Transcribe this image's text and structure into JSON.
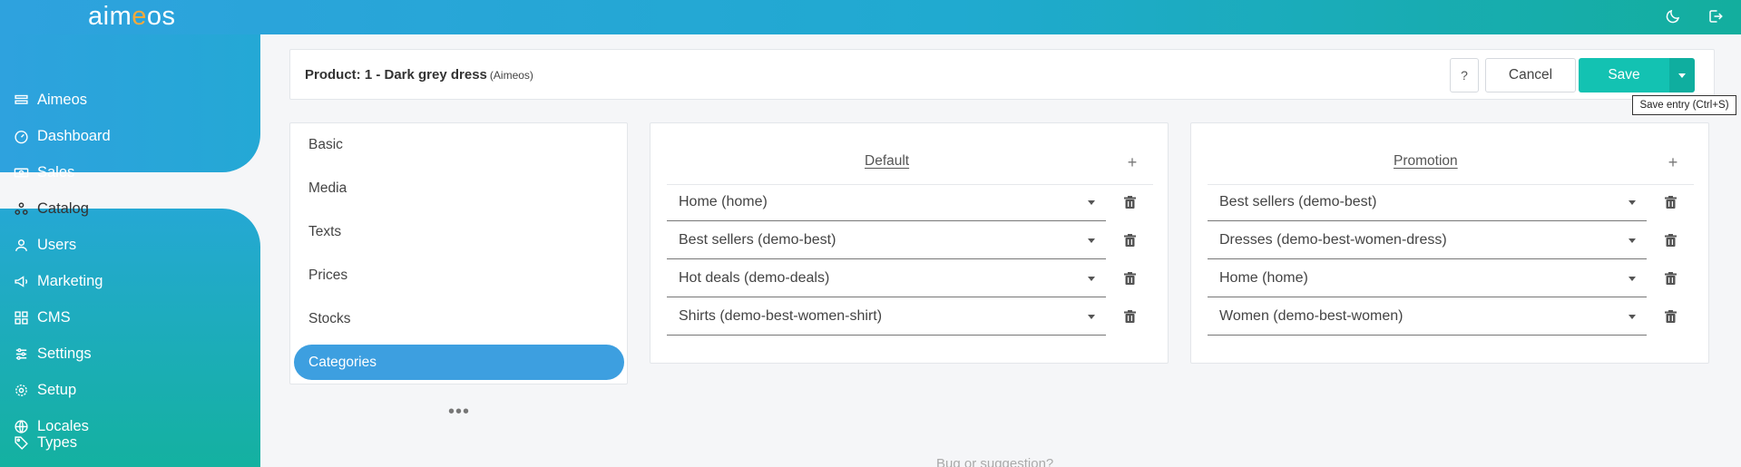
{
  "app": {
    "logo_text_before": "aim",
    "logo_text_e": "e",
    "logo_text_after": "os"
  },
  "topbar": {
    "icons": [
      "moon-icon",
      "logout-icon"
    ]
  },
  "sidebar": {
    "items": [
      {
        "label": "Aimeos",
        "icon": "list-icon",
        "active": false
      },
      {
        "label": "Dashboard",
        "icon": "gauge-icon",
        "active": false
      },
      {
        "label": "Sales",
        "icon": "money-icon",
        "active": false
      },
      {
        "label": "Catalog",
        "icon": "tree-icon",
        "active": true
      },
      {
        "label": "Users",
        "icon": "user-icon",
        "active": false
      },
      {
        "label": "Marketing",
        "icon": "megaphone-icon",
        "active": false
      },
      {
        "label": "CMS",
        "icon": "grid-icon",
        "active": false
      },
      {
        "label": "Settings",
        "icon": "sliders-icon",
        "active": false
      },
      {
        "label": "Setup",
        "icon": "gear-icon",
        "active": false
      },
      {
        "label": "Locales",
        "icon": "globe-icon",
        "active": false
      },
      {
        "label": "Types",
        "icon": "tag-icon",
        "active": false
      }
    ]
  },
  "header": {
    "title": "Product: 1 - Dark grey dress",
    "site": "(Aimeos)",
    "help_label": "?",
    "cancel_label": "Cancel",
    "save_label": "Save",
    "save_tooltip": "Save entry (Ctrl+S)"
  },
  "tabs": [
    {
      "label": "Basic",
      "active": false
    },
    {
      "label": "Media",
      "active": false
    },
    {
      "label": "Texts",
      "active": false
    },
    {
      "label": "Prices",
      "active": false
    },
    {
      "label": "Stocks",
      "active": false
    },
    {
      "label": "Categories",
      "active": true
    }
  ],
  "more_label": "•••",
  "panels": {
    "default": {
      "title": "Default",
      "add_label": "+",
      "rows": [
        "Home (home)",
        "Best sellers (demo-best)",
        "Hot deals (demo-deals)",
        "Shirts (demo-best-women-shirt)"
      ]
    },
    "promotion": {
      "title": "Promotion",
      "add_label": "+",
      "rows": [
        "Best sellers (demo-best)",
        "Dresses (demo-best-women-dress)",
        "Home (home)",
        "Women (demo-best-women)"
      ]
    }
  },
  "footer": {
    "link": "Bug or suggestion?"
  },
  "colors": {
    "brand_blue": "#2ea2de",
    "brand_teal": "#13ae9e",
    "save_green": "#13c2b2",
    "active_tab": "#3d9fe0",
    "logo_accent": "#f6a93b"
  }
}
